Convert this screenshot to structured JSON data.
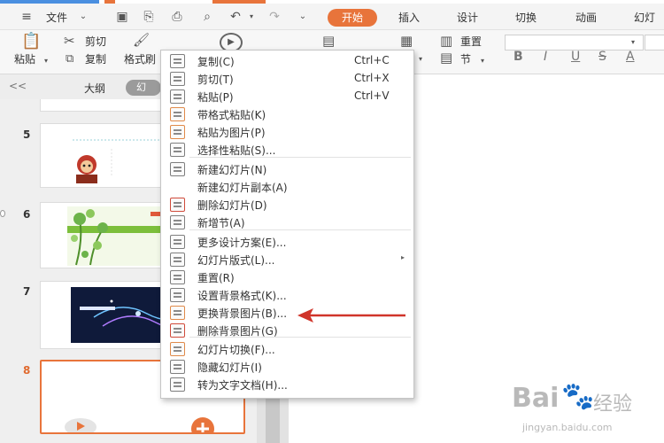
{
  "menubar": {
    "file": "文件",
    "tabs": [
      "开始",
      "插入",
      "设计",
      "切换",
      "动画",
      "幻灯"
    ]
  },
  "ribbon": {
    "paste": "粘贴",
    "cut": "剪切",
    "copy": "复制",
    "format_painter": "格式刷",
    "reset": "重置",
    "section": "节",
    "format_letters": [
      "B",
      "I",
      "U",
      "S",
      "A"
    ]
  },
  "panel": {
    "collapse": "<<",
    "outline": "大纲",
    "slides": "幻",
    "slide_numbers": [
      "5",
      "6",
      "7",
      "8"
    ]
  },
  "context_menu": {
    "items": [
      {
        "label": "复制(C)",
        "shortcut": "Ctrl+C",
        "icon": "copy-icon"
      },
      {
        "label": "剪切(T)",
        "shortcut": "Ctrl+X",
        "icon": "scissors-icon"
      },
      {
        "label": "粘贴(P)",
        "shortcut": "Ctrl+V",
        "icon": "paste-icon"
      },
      {
        "label": "带格式粘贴(K)",
        "icon": "paste-format-icon"
      },
      {
        "label": "粘贴为图片(P)",
        "icon": "paste-picture-icon"
      },
      {
        "label": "选择性粘贴(S)...",
        "icon": "paste-special-icon"
      },
      {
        "label": "新建幻灯片(N)",
        "icon": "new-slide-icon"
      },
      {
        "label": "新建幻灯片副本(A)",
        "icon": ""
      },
      {
        "label": "删除幻灯片(D)",
        "icon": "delete-slide-icon"
      },
      {
        "label": "新增节(A)",
        "icon": "new-section-icon"
      },
      {
        "label": "更多设计方案(E)...",
        "icon": "design-icon"
      },
      {
        "label": "幻灯片版式(L)...",
        "icon": "layout-icon"
      },
      {
        "label": "重置(R)",
        "icon": "reset-icon"
      },
      {
        "label": "设置背景格式(K)...",
        "icon": "background-format-icon"
      },
      {
        "label": "更换背景图片(B)...",
        "icon": "change-background-icon"
      },
      {
        "label": "删除背景图片(G)",
        "icon": "delete-background-icon"
      },
      {
        "label": "幻灯片切换(F)...",
        "icon": "transition-icon"
      },
      {
        "label": "隐藏幻灯片(I)",
        "icon": "hide-slide-icon"
      },
      {
        "label": "转为文字文档(H)...",
        "icon": "convert-doc-icon"
      }
    ]
  },
  "watermark": {
    "brand": "Bai",
    "brand2": "经验",
    "url": "jingyan.baidu.com"
  },
  "colors": {
    "accent": "#e8743b",
    "active_slide": "#e06a2f",
    "arrow": "#d0342a"
  }
}
